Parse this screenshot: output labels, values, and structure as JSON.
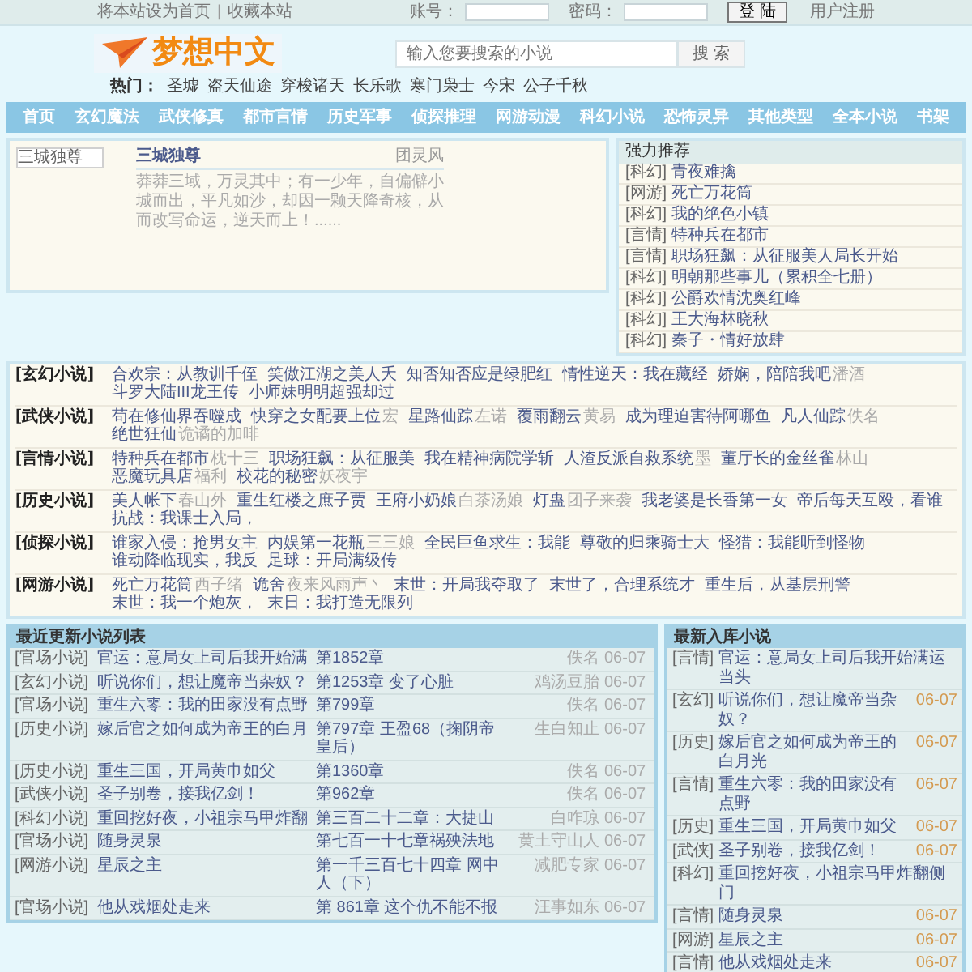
{
  "top_bar": {
    "links": [
      "将本站设为首页",
      "收藏本站"
    ],
    "separator": "|",
    "account_label": "账号：",
    "password_label": "密码：",
    "login_button": "登 陆",
    "register_link": "用户注册"
  },
  "logo": {
    "text": "梦想中文"
  },
  "search": {
    "placeholder": "输入您要搜索的小说",
    "button": "搜 索"
  },
  "hot": {
    "label": "热门：",
    "items": [
      "圣墟",
      "盗天仙途",
      "穿梭诸天",
      "长乐歌",
      "寒门枭士",
      "今宋",
      "公子千秋"
    ]
  },
  "nav": [
    "首页",
    "玄幻魔法",
    "武侠修真",
    "都市言情",
    "历史军事",
    "侦探推理",
    "网游动漫",
    "科幻小说",
    "恐怖灵异",
    "其他类型",
    "全本小说",
    "书架"
  ],
  "featured": {
    "image_alt": "三城独尊",
    "title": "三城独尊",
    "author": "团灵风",
    "description": "莽莽三域，万灵其中；有一少年，自偏僻小城而出，平凡如沙，却因一颗天降奇核，从而改写命运，逆天而上！......"
  },
  "recommend": {
    "title": "强力推荐",
    "items": [
      {
        "tag": "[科幻]",
        "title": "青夜难擒"
      },
      {
        "tag": "[网游]",
        "title": "死亡万花筒"
      },
      {
        "tag": "[科幻]",
        "title": "我的绝色小镇"
      },
      {
        "tag": "[言情]",
        "title": "特种兵在都市"
      },
      {
        "tag": "[言情]",
        "title": "职场狂飙：从征服美人局长开始"
      },
      {
        "tag": "[科幻]",
        "title": "明朝那些事儿（累积全七册）"
      },
      {
        "tag": "[科幻]",
        "title": "公爵欢情沈奥红峰"
      },
      {
        "tag": "[科幻]",
        "title": "王大海林晓秋"
      },
      {
        "tag": "[科幻]",
        "title": "秦子・情好放肆"
      }
    ]
  },
  "categories": [
    {
      "label": "[玄幻小说]",
      "items": [
        {
          "title": "合欢宗：从教训千侄"
        },
        {
          "title": "笑傲江湖之美人夭"
        },
        {
          "title": "知否知否应是绿肥红"
        },
        {
          "title": "情性逆天：我在藏经"
        },
        {
          "title": "娇娴，陪陪我吧",
          "author": "潘酒"
        },
        {
          "title": "斗罗大陆III龙王传"
        },
        {
          "title": "小师妹明明超强却过"
        }
      ]
    },
    {
      "label": "[武侠小说]",
      "items": [
        {
          "title": "苟在修仙界吞噬成"
        },
        {
          "title": "快穿之女配要上位",
          "author": "宏"
        },
        {
          "title": "星路仙踪",
          "author": "左诺"
        },
        {
          "title": "覆雨翻云",
          "author": "黄易"
        },
        {
          "title": "成为理迫害待阿哪鱼"
        },
        {
          "title": "凡人仙踪",
          "author": "佚名"
        },
        {
          "title": "绝世狂仙",
          "author": "诡谲的加啡"
        }
      ]
    },
    {
      "label": "[言情小说]",
      "items": [
        {
          "title": "特种兵在都市",
          "author": "枕十三"
        },
        {
          "title": "职场狂飙：从征服美"
        },
        {
          "title": "我在精神病院学斩"
        },
        {
          "title": "人渣反派自救系统",
          "author": "墨"
        },
        {
          "title": "董厅长的金丝雀",
          "author": "林山"
        },
        {
          "title": "恶魔玩具店",
          "author": "福利"
        },
        {
          "title": "校花的秘密",
          "author": "妖夜宇"
        }
      ]
    },
    {
      "label": "[历史小说]",
      "items": [
        {
          "title": "美人帐下",
          "author": "春山外"
        },
        {
          "title": "重生红楼之庶子贾"
        },
        {
          "title": "王府小奶娘",
          "author": "白茶汤娘"
        },
        {
          "title": "灯蛊",
          "author": "团子来袭"
        },
        {
          "title": "我老婆是长香第一女"
        },
        {
          "title": "帝后每天互殴，看谁"
        },
        {
          "title": "抗战：我课士入局，"
        }
      ]
    },
    {
      "label": "[侦探小说]",
      "items": [
        {
          "title": "谁家入侵：抢男女主"
        },
        {
          "title": "内娱第一花瓶",
          "author": "三三娘"
        },
        {
          "title": "全民巨鱼求生：我能"
        },
        {
          "title": "尊敬的归乘骑士大"
        },
        {
          "title": "怪猎：我能听到怪物"
        },
        {
          "title": "谁动降临现实，我反"
        },
        {
          "title": "足球：开局满级传"
        }
      ]
    },
    {
      "label": "[网游小说]",
      "items": [
        {
          "title": "死亡万花筒",
          "author": "西子绪"
        },
        {
          "title": "诡舍",
          "author": "夜来风雨声丶"
        },
        {
          "title": "末世：开局我夺取了"
        },
        {
          "title": "末世了，合理系统才"
        },
        {
          "title": "重生后，从基层刑警"
        },
        {
          "title": "末世：我一个炮灰，"
        },
        {
          "title": "末日：我打造无限列"
        }
      ]
    }
  ],
  "recent": {
    "title": "最近更新小说列表",
    "rows": [
      {
        "category": "[官场小说]",
        "title": "官运：意局女上司后我开始满",
        "chapter": "第1852章",
        "author": "佚名",
        "date": "06-07"
      },
      {
        "category": "[玄幻小说]",
        "title": "听说你们，想让魔帝当杂奴？",
        "chapter": "第1253章 变了心脏",
        "author": "鸡汤豆胎",
        "date": "06-07"
      },
      {
        "category": "[官场小说]",
        "title": "重生六零：我的田家没有点野",
        "chapter": "第799章",
        "author": "佚名",
        "date": "06-07"
      },
      {
        "category": "[历史小说]",
        "title": "嫁后官之如何成为帝王的白月",
        "chapter": "第797章 王盈68（掬阴帝皇后）",
        "author": "生白知止",
        "date": "06-07"
      },
      {
        "category": "[历史小说]",
        "title": "重生三国，开局黄巾如父",
        "chapter": "第1360章",
        "author": "佚名",
        "date": "06-07"
      },
      {
        "category": "[武侠小说]",
        "title": "圣子别卷，接我亿剑！",
        "chapter": "第962章",
        "author": "佚名",
        "date": "06-07"
      },
      {
        "category": "[科幻小说]",
        "title": "重回挖好夜，小祖宗马甲炸翻",
        "chapter": "第三百二十二章：大捷山",
        "author": "白咋琼",
        "date": "06-07"
      },
      {
        "category": "[官场小说]",
        "title": "随身灵泉",
        "chapter": "第七百一十七章祸殃法地",
        "author": "黄土守山人",
        "date": "06-07"
      },
      {
        "category": "[网游小说]",
        "title": "星辰之主",
        "chapter": "第一千三百七十四章 网中人（下）",
        "author": "减肥专家",
        "date": "06-07"
      },
      {
        "category": "[官场小说]",
        "title": "他从戏烟处走来",
        "chapter": "第 861章 这个仇不能不报",
        "author": "汪事如东",
        "date": "06-07"
      }
    ]
  },
  "newest": {
    "title": "最新入库小说",
    "rows": [
      {
        "tag": "[言情]",
        "title": "官运：意局女上司后我开始满运当头"
      },
      {
        "tag": "[玄幻]",
        "title": "听说你们，想让魔帝当杂奴？",
        "date": "06-07"
      },
      {
        "tag": "[历史]",
        "title": "嫁后官之如何成为帝王的白月光",
        "date": "06-07"
      },
      {
        "tag": "[言情]",
        "title": "重生六零：我的田家没有点野",
        "date": "06-07"
      },
      {
        "tag": "[历史]",
        "title": "重生三国，开局黄巾如父",
        "date": "06-07"
      },
      {
        "tag": "[武侠]",
        "title": "圣子别卷，接我亿剑！",
        "date": "06-07"
      },
      {
        "tag": "[科幻]",
        "title": "重回挖好夜，小祖宗马甲炸翻侧门"
      },
      {
        "tag": "[言情]",
        "title": "随身灵泉",
        "date": "06-07"
      },
      {
        "tag": "[网游]",
        "title": "星辰之主",
        "date": "06-07"
      },
      {
        "tag": "[言情]",
        "title": "他从戏烟处走来",
        "date": "06-07"
      }
    ]
  }
}
